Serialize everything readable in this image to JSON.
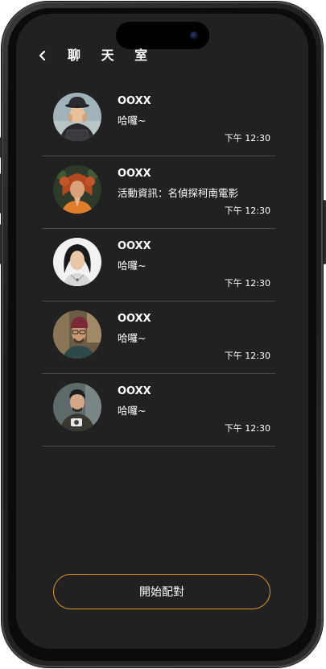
{
  "header": {
    "title": "聊 天 室",
    "back_icon": "chevron-left-icon"
  },
  "chats": [
    {
      "name": "OOXX",
      "message": "哈囉~",
      "time": "下午 12:30"
    },
    {
      "name": "OOXX",
      "message": "活動資訊：名偵探柯南電影",
      "time": "下午 12:30"
    },
    {
      "name": "OOXX",
      "message": "哈囉~",
      "time": "下午 12:30"
    },
    {
      "name": "OOXX",
      "message": "哈囉~",
      "time": "下午 12:30"
    },
    {
      "name": "OOXX",
      "message": "哈囉~",
      "time": "下午 12:30"
    }
  ],
  "footer": {
    "match_label": "開始配對"
  },
  "colors": {
    "background": "#212121",
    "accent": "#e09a2a",
    "divider": "#4a4a4a",
    "text": "#ffffff"
  }
}
